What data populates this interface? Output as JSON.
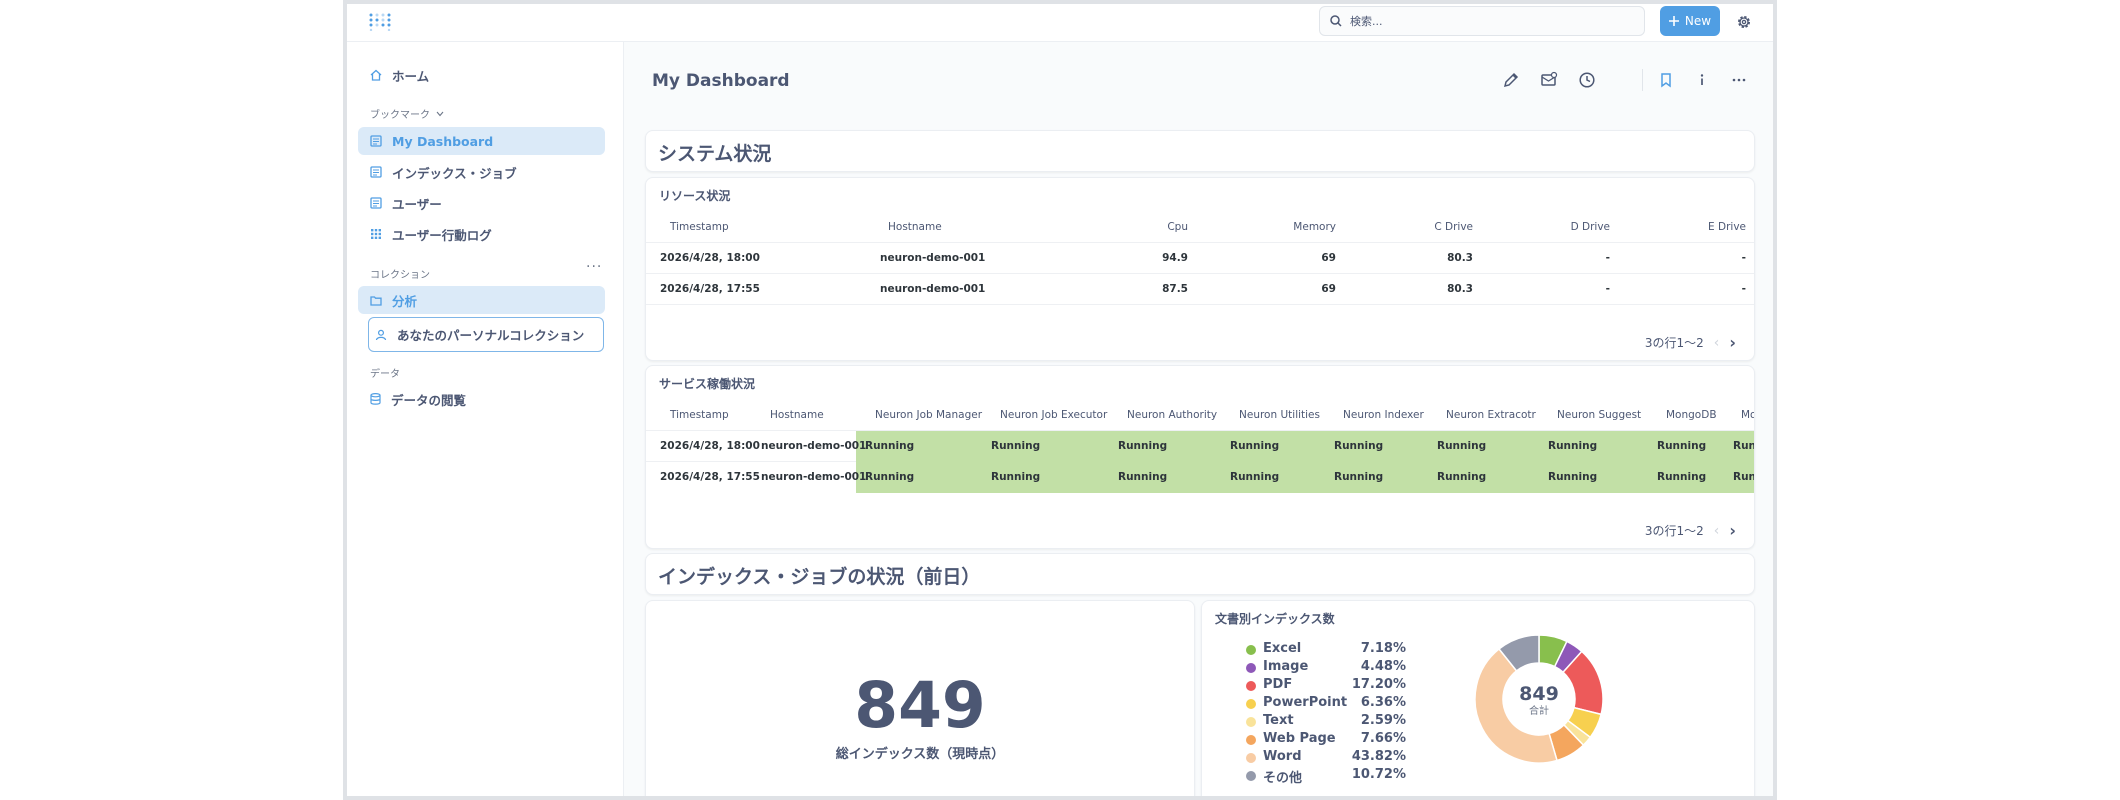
{
  "topbar": {
    "search_placeholder": "検索...",
    "new_label": "New"
  },
  "sidebar": {
    "home": "ホーム",
    "bookmarks_label": "ブックマーク",
    "bookmarks": [
      "My Dashboard",
      "インデックス・ジョブ",
      "ユーザー",
      "ユーザー行動ログ"
    ],
    "collections_label": "コレクション",
    "collections": [
      "分析",
      "あなたのパーソナルコレクション"
    ],
    "data_label": "データ",
    "data_items": [
      "データの閲覧"
    ]
  },
  "dashboard": {
    "title": "My Dashboard"
  },
  "sections": {
    "system_status": "システム状況",
    "index_job_status": "インデックス・ジョブの状況（前日）"
  },
  "resource": {
    "title": "リソース状況",
    "columns": [
      "Timestamp",
      "Hostname",
      "Cpu",
      "Memory",
      "C Drive",
      "D Drive",
      "E Drive"
    ],
    "rows": [
      [
        "2026/4/28, 18:00",
        "neuron-demo-001",
        "94.9",
        "69",
        "80.3",
        "-",
        "-"
      ],
      [
        "2026/4/28, 17:55",
        "neuron-demo-001",
        "87.5",
        "69",
        "80.3",
        "-",
        "-"
      ]
    ],
    "pager": "3の行1〜2"
  },
  "service": {
    "title": "サービス稼働状況",
    "columns": [
      "Timestamp",
      "Hostname",
      "Neuron Job Manager",
      "Neuron Job Executor",
      "Neuron Authority",
      "Neuron Utilities",
      "Neuron Indexer",
      "Neuron Extracotr",
      "Neuron Suggest",
      "MongoDB",
      "Mo"
    ],
    "rows": [
      [
        "2026/4/28, 18:00",
        "neuron-demo-001",
        "Running",
        "Running",
        "Running",
        "Running",
        "Running",
        "Running",
        "Running",
        "Running",
        "Runn"
      ],
      [
        "2026/4/28, 17:55",
        "neuron-demo-001",
        "Running",
        "Running",
        "Running",
        "Running",
        "Running",
        "Running",
        "Running",
        "Running",
        "Runn"
      ]
    ],
    "status_color": "#c2e0a6",
    "pager": "3の行1〜2"
  },
  "total_index": {
    "value": "849",
    "label": "総インデックス数（現時点）"
  },
  "doc_index": {
    "title": "文書別インデックス数",
    "center_value": "849",
    "center_label": "合計",
    "items": [
      {
        "name": "Excel",
        "pct": "7.18%",
        "value": 7.18,
        "color": "#88bf4d"
      },
      {
        "name": "Image",
        "pct": "4.48%",
        "value": 4.48,
        "color": "#8e58b8"
      },
      {
        "name": "PDF",
        "pct": "17.20%",
        "value": 17.2,
        "color": "#ed5a5a"
      },
      {
        "name": "PowerPoint",
        "pct": "6.36%",
        "value": 6.36,
        "color": "#f7d04f"
      },
      {
        "name": "Text",
        "pct": "2.59%",
        "value": 2.59,
        "color": "#f9e39a"
      },
      {
        "name": "Web Page",
        "pct": "7.66%",
        "value": 7.66,
        "color": "#f4a65e"
      },
      {
        "name": "Word",
        "pct": "43.82%",
        "value": 43.82,
        "color": "#f8cca4"
      },
      {
        "name": "その他",
        "pct": "10.72%",
        "value": 10.72,
        "color": "#949aab"
      }
    ]
  }
}
